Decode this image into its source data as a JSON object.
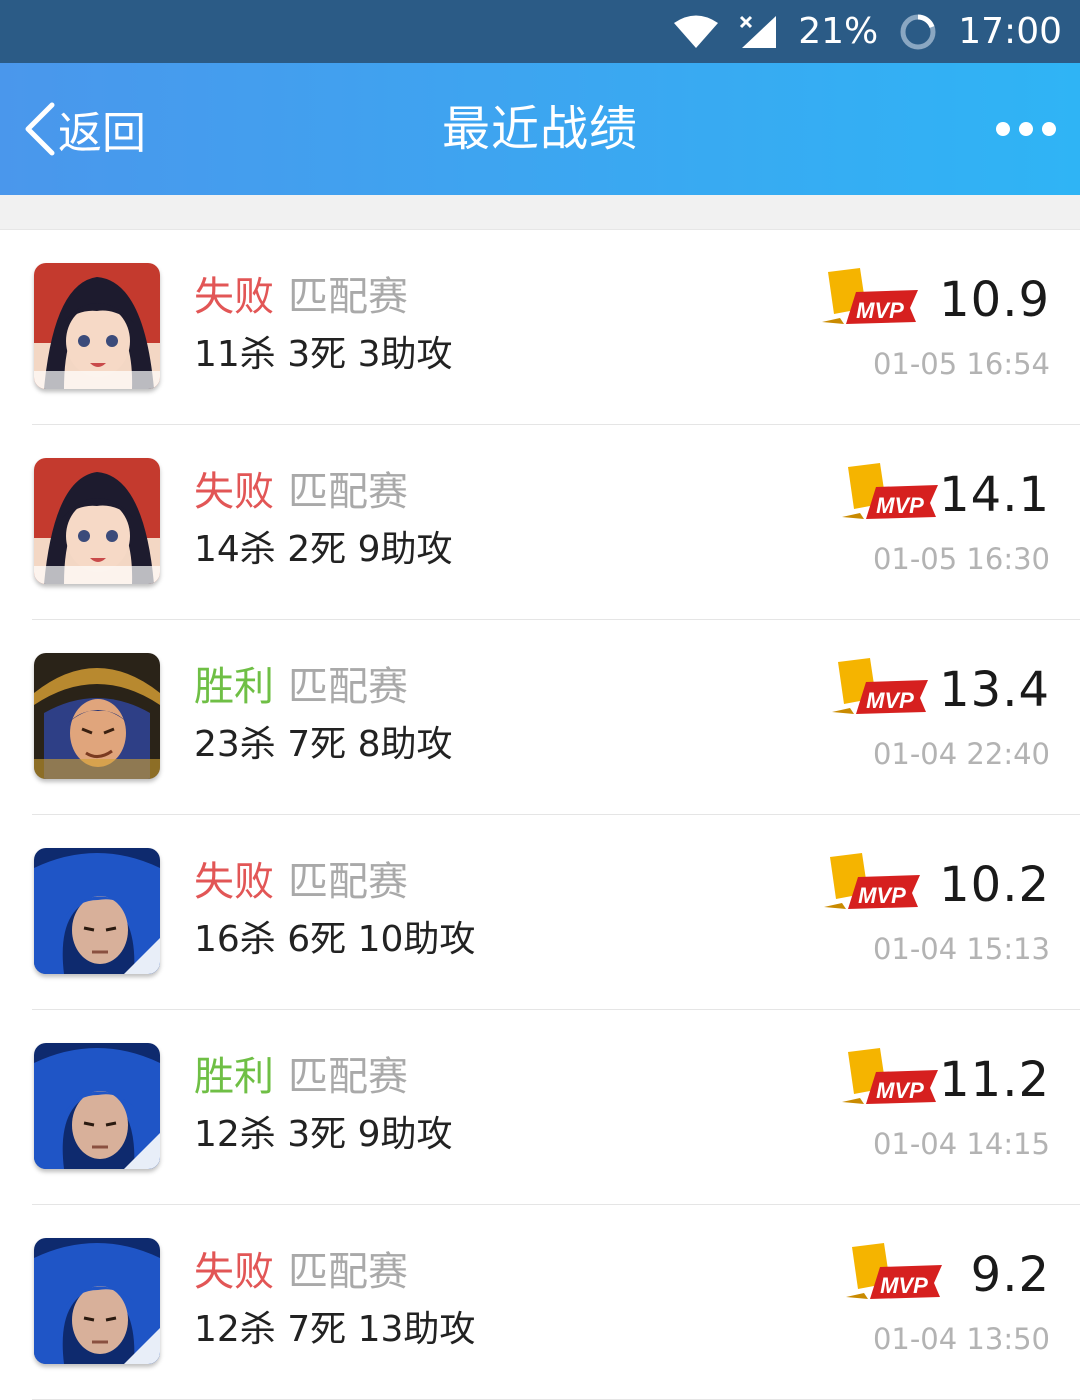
{
  "status_bar": {
    "battery": "21%",
    "time": "17:00"
  },
  "header": {
    "back_label": "返回",
    "title": "最近战绩"
  },
  "records": [
    {
      "result": "失败",
      "outcome": "loss",
      "mode": "匹配赛",
      "stats": "11杀 3死 3助攻",
      "badge": "MVP",
      "score": "10.9",
      "time": "01-05 16:54",
      "hero_icon": "red-haired-girl-hero-avatar"
    },
    {
      "result": "失败",
      "outcome": "loss",
      "mode": "匹配赛",
      "stats": "14杀 2死 9助攻",
      "badge": "MVP",
      "score": "14.1",
      "time": "01-05 16:30",
      "hero_icon": "red-haired-girl-hero-avatar"
    },
    {
      "result": "胜利",
      "outcome": "win",
      "mode": "匹配赛",
      "stats": "23杀 7死 8助攻",
      "badge": "MVP",
      "score": "13.4",
      "time": "01-04 22:40",
      "hero_icon": "hat-swordsman-hero-avatar"
    },
    {
      "result": "失败",
      "outcome": "loss",
      "mode": "匹配赛",
      "stats": "16杀 6死 10助攻",
      "badge": "MVP",
      "score": "10.2",
      "time": "01-04 15:13",
      "hero_icon": "blue-haired-hero-avatar"
    },
    {
      "result": "胜利",
      "outcome": "win",
      "mode": "匹配赛",
      "stats": "12杀 3死 9助攻",
      "badge": "MVP",
      "score": "11.2",
      "time": "01-04 14:15",
      "hero_icon": "blue-haired-hero-avatar"
    },
    {
      "result": "失败",
      "outcome": "loss",
      "mode": "匹配赛",
      "stats": "12杀 7死 13助攻",
      "badge": "MVP",
      "score": "9.2",
      "time": "01-04 13:50",
      "hero_icon": "blue-haired-hero-avatar"
    }
  ],
  "colors": {
    "loss": "#e25656",
    "win": "#6fbf45",
    "header_start": "#4a97ec",
    "header_end": "#2fb4f5",
    "status_bar": "#2b5b86"
  }
}
